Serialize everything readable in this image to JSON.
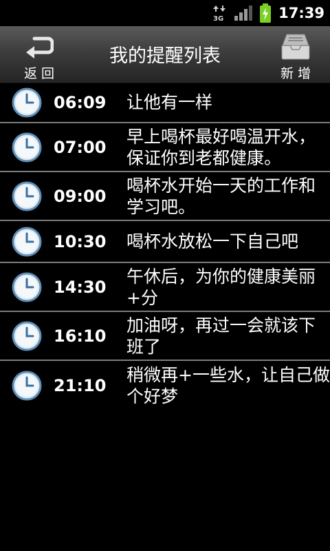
{
  "status": {
    "network": "3G",
    "time": "17:39",
    "colors": {
      "battery": "#7ad023"
    }
  },
  "toolbar": {
    "back_label": "返回",
    "title": "我的提醒列表",
    "add_label": "新增"
  },
  "reminders": [
    {
      "time": "06:09",
      "text": "让他有一样"
    },
    {
      "time": "07:00",
      "text": "早上喝杯最好喝温开水，保证你到老都健康。"
    },
    {
      "time": "09:00",
      "text": "喝杯水开始一天的工作和学习吧。"
    },
    {
      "time": "10:30",
      "text": "喝杯水放松一下自己吧"
    },
    {
      "time": "14:30",
      "text": "午休后，为你的健康美丽+分"
    },
    {
      "time": "16:10",
      "text": "加油呀，再过一会就该下班了"
    },
    {
      "time": "21:10",
      "text": "稍微再+一些水，让自己做个好梦"
    }
  ]
}
